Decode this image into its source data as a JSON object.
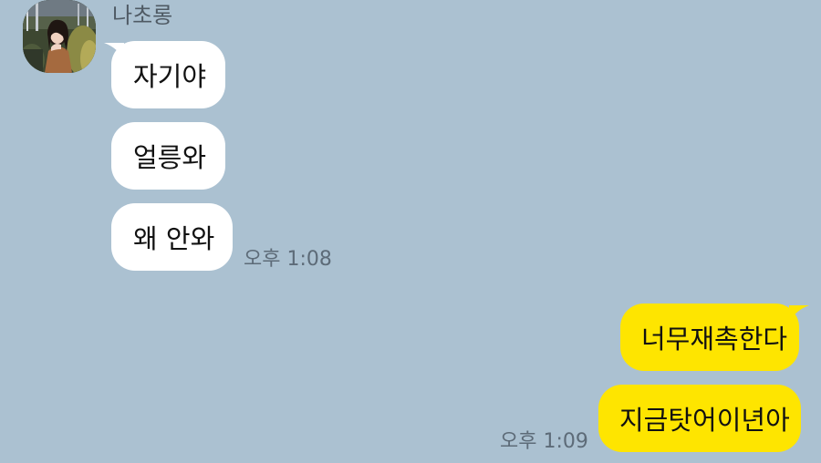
{
  "colors": {
    "background": "#abc1d1",
    "incoming_bubble": "#ffffff",
    "outgoing_bubble": "#fee500",
    "timestamp": "#5d6b78",
    "sender_name": "#4f5a64"
  },
  "sender": {
    "name": "나초롱",
    "avatar": "profile-photo"
  },
  "incoming": {
    "messages": [
      "자기야",
      "얼릉와",
      "왜 안와"
    ],
    "time": "오후 1:08"
  },
  "outgoing": {
    "messages": [
      "너무재촉한다",
      "지금탓어이년아"
    ],
    "time": "오후 1:09"
  }
}
